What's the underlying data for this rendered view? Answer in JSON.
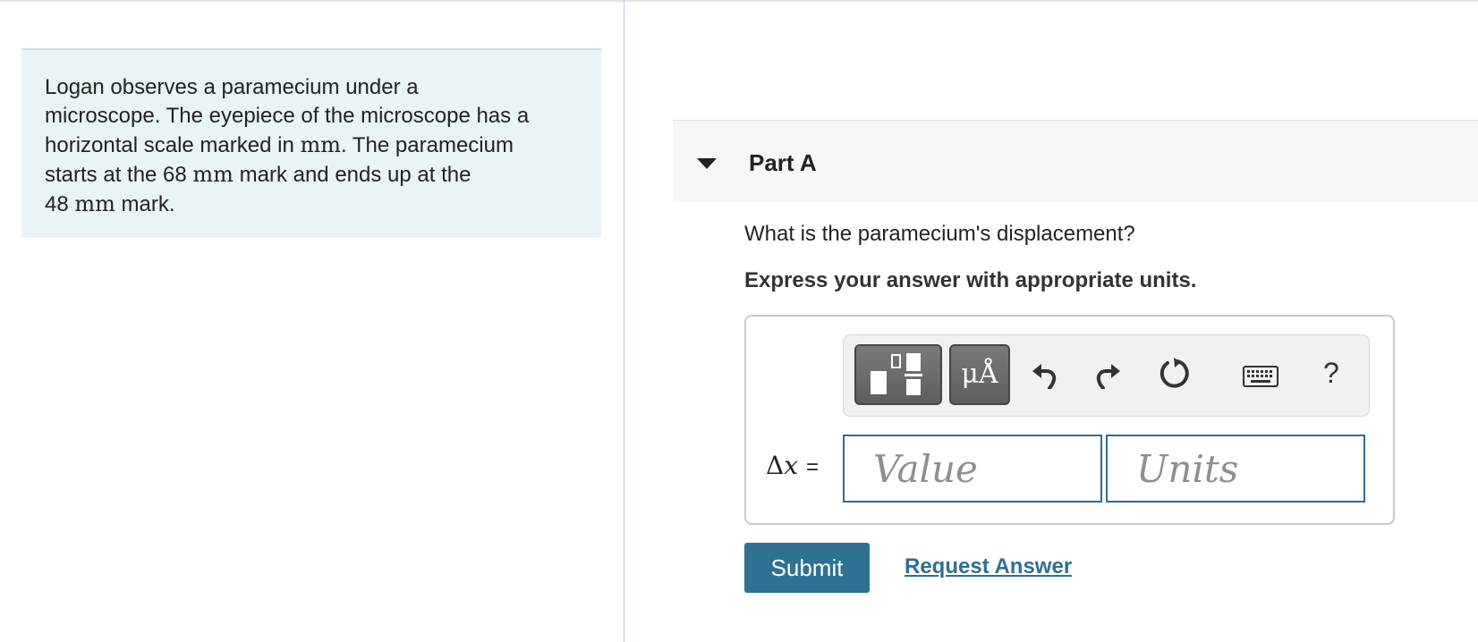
{
  "problem": {
    "line1": "Logan observes a paramecium under a",
    "line2": "microscope. The eyepiece of the microscope has a",
    "line3_a": "horizontal scale marked in ",
    "line3_unit": "mm",
    "line3_b": ". The paramecium",
    "line4_a": "starts at the 68 ",
    "line4_unit": "mm",
    "line4_b": " mark and ends up at the",
    "line5_a": "48 ",
    "line5_unit": "mm",
    "line5_b": " mark."
  },
  "part": {
    "title": "Part A",
    "question": "What is the paramecium's displacement?",
    "instruction": "Express your answer with appropriate units."
  },
  "toolbar": {
    "templates_icon": "fraction-templates-icon",
    "symbols_label": "μÅ",
    "undo_icon": "undo-icon",
    "redo_icon": "redo-icon",
    "reset_icon": "reset-icon",
    "keyboard_icon": "keyboard-icon",
    "help_label": "?"
  },
  "answer": {
    "variable": "Δ",
    "variable_symbol": "x",
    "equals": "=",
    "value_placeholder": "Value",
    "units_placeholder": "Units"
  },
  "actions": {
    "submit_label": "Submit",
    "request_label": "Request Answer"
  },
  "colors": {
    "problem_bg": "#e8f4f6",
    "accent": "#2e7191",
    "input_border": "#2e6e8e"
  }
}
